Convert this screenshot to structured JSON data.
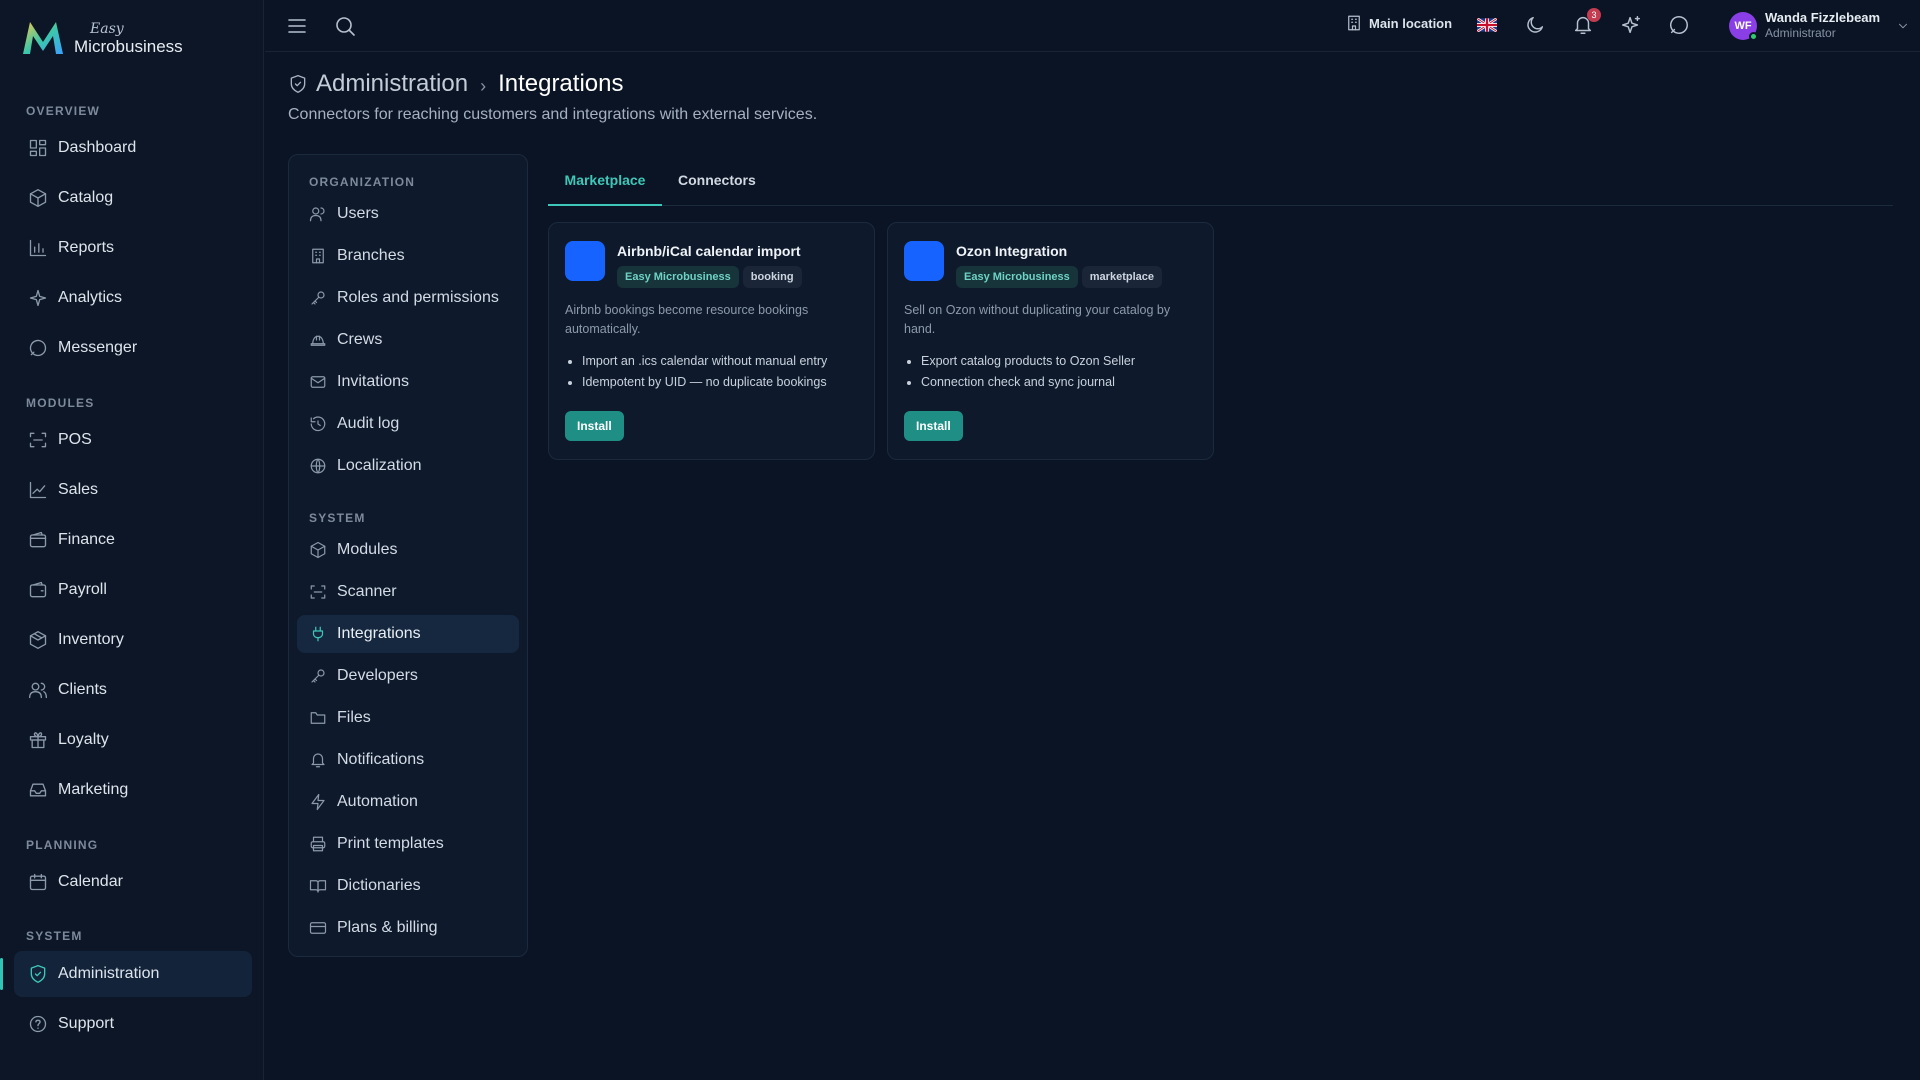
{
  "brand": {
    "top": "Easy",
    "bottom": "Microbusiness"
  },
  "sidebar": {
    "sections": [
      {
        "label": "OVERVIEW",
        "items": [
          {
            "label": "Dashboard",
            "icon": "dashboard-icon"
          },
          {
            "label": "Catalog",
            "icon": "box-icon"
          },
          {
            "label": "Reports",
            "icon": "bar-chart-icon"
          },
          {
            "label": "Analytics",
            "icon": "sparkles-icon"
          },
          {
            "label": "Messenger",
            "icon": "message-icon"
          }
        ]
      },
      {
        "label": "MODULES",
        "items": [
          {
            "label": "POS",
            "icon": "scan-icon"
          },
          {
            "label": "Sales",
            "icon": "line-chart-icon"
          },
          {
            "label": "Finance",
            "icon": "wallet-icon"
          },
          {
            "label": "Payroll",
            "icon": "wallet-icon"
          },
          {
            "label": "Inventory",
            "icon": "package-icon"
          },
          {
            "label": "Clients",
            "icon": "users-icon"
          },
          {
            "label": "Loyalty",
            "icon": "gift-icon"
          },
          {
            "label": "Marketing",
            "icon": "inbox-icon"
          }
        ]
      },
      {
        "label": "PLANNING",
        "items": [
          {
            "label": "Calendar",
            "icon": "calendar-icon"
          }
        ]
      },
      {
        "label": "SYSTEM",
        "items": [
          {
            "label": "Administration",
            "icon": "shield-icon",
            "active": true
          },
          {
            "label": "Support",
            "icon": "help-circle-icon"
          }
        ]
      }
    ]
  },
  "topbar": {
    "location": "Main location",
    "notifications_count": "3",
    "user": {
      "initials": "WF",
      "name": "Wanda Fizzlebeam",
      "role": "Administrator"
    }
  },
  "page": {
    "breadcrumb_parent": "Administration",
    "breadcrumb_sep": "›",
    "title": "Integrations",
    "subtitle": "Connectors for reaching customers and integrations with external services."
  },
  "subnav": {
    "sections": [
      {
        "label": "ORGANIZATION",
        "items": [
          {
            "label": "Users",
            "icon": "users-icon"
          },
          {
            "label": "Branches",
            "icon": "building-icon"
          },
          {
            "label": "Roles and permissions",
            "icon": "key-icon"
          },
          {
            "label": "Crews",
            "icon": "hard-hat-icon"
          },
          {
            "label": "Invitations",
            "icon": "mail-icon"
          },
          {
            "label": "Audit log",
            "icon": "history-icon"
          },
          {
            "label": "Localization",
            "icon": "globe-icon"
          }
        ]
      },
      {
        "label": "SYSTEM",
        "items": [
          {
            "label": "Modules",
            "icon": "package-icon"
          },
          {
            "label": "Scanner",
            "icon": "scan-icon"
          },
          {
            "label": "Integrations",
            "icon": "plug-icon",
            "active": true
          },
          {
            "label": "Developers",
            "icon": "key-icon"
          },
          {
            "label": "Files",
            "icon": "folder-icon"
          },
          {
            "label": "Notifications",
            "icon": "bell-icon"
          },
          {
            "label": "Automation",
            "icon": "zap-icon"
          },
          {
            "label": "Print templates",
            "icon": "printer-icon"
          },
          {
            "label": "Dictionaries",
            "icon": "book-icon"
          },
          {
            "label": "Plans & billing",
            "icon": "credit-card-icon"
          }
        ]
      }
    ]
  },
  "tabs": [
    {
      "label": "Marketplace",
      "active": true
    },
    {
      "label": "Connectors",
      "active": false
    }
  ],
  "cards": [
    {
      "title": "Airbnb/iCal calendar import",
      "tags": [
        "Easy Microbusiness",
        "booking"
      ],
      "description": "Airbnb bookings become resource bookings automatically.",
      "bullets": [
        "Import an .ics calendar without manual entry",
        "Idempotent by UID — no duplicate bookings"
      ],
      "button": "Install"
    },
    {
      "title": "Ozon Integration",
      "tags": [
        "Easy Microbusiness",
        "marketplace"
      ],
      "description": "Sell on Ozon without duplicating your catalog by hand.",
      "bullets": [
        "Export catalog products to Ozon Seller",
        "Connection check and sync journal"
      ],
      "button": "Install"
    }
  ],
  "colors": {
    "accent": "#3ec7b8",
    "card_icon": "#1663ff",
    "button": "#1f8f86",
    "avatar": "#8a3ee6"
  }
}
